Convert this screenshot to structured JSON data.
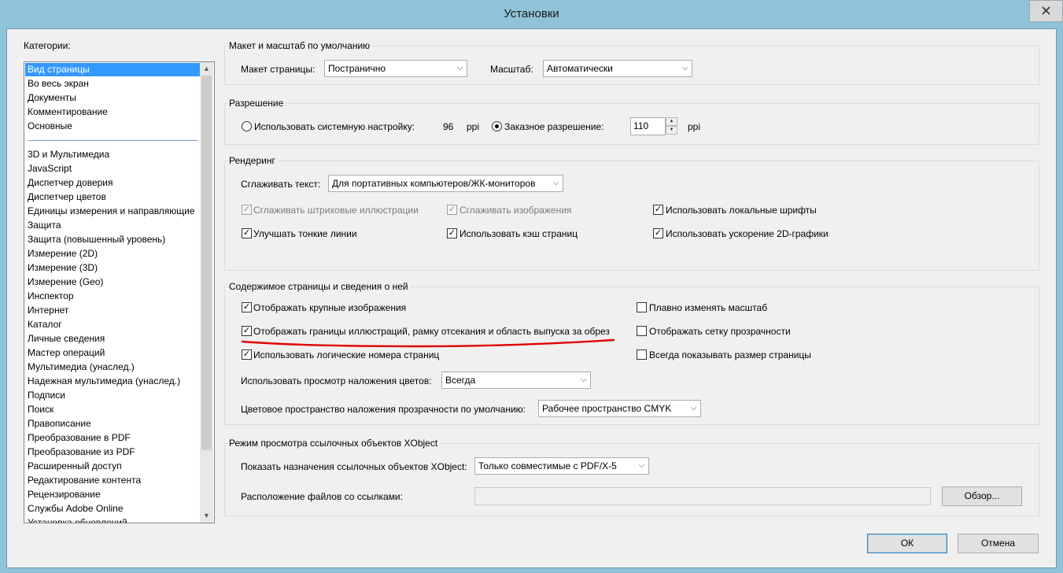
{
  "window": {
    "title": "Установки"
  },
  "categories": {
    "label": "Категории:",
    "group1": [
      "Вид страницы",
      "Во весь экран",
      "Документы",
      "Комментирование",
      "Основные"
    ],
    "group2": [
      "3D и Мультимедиа",
      "JavaScript",
      "Диспетчер доверия",
      "Диспетчер цветов",
      "Единицы измерения и направляющие",
      "Защита",
      "Защита (повышенный уровень)",
      "Измерение (2D)",
      "Измерение (3D)",
      "Измерение (Geo)",
      "Инспектор",
      "Интернет",
      "Каталог",
      "Личные сведения",
      "Мастер операций",
      "Мультимедиа (унаслед.)",
      "Надежная мультимедиа (унаслед.)",
      "Подписи",
      "Поиск",
      "Правописание",
      "Преобразование в PDF",
      "Преобразование из PDF",
      "Расширенный доступ",
      "Редактирование контента",
      "Рецензирование",
      "Службы Adobe Online",
      "Установка обновлений"
    ],
    "selected": "Вид страницы"
  },
  "layout_group": {
    "title": "Макет и масштаб по умолчанию",
    "page_layout_label": "Макет страницы:",
    "page_layout_value": "Постранично",
    "zoom_label": "Масштаб:",
    "zoom_value": "Автоматически"
  },
  "resolution_group": {
    "title": "Разрешение",
    "system_label": "Использовать системную настройку:",
    "system_value": "96",
    "unit": "ppi",
    "custom_label": "Заказное разрешение:",
    "custom_value": "110",
    "custom_unit": "ppi"
  },
  "rendering_group": {
    "title": "Рендеринг",
    "smooth_text_label": "Сглаживать текст:",
    "smooth_text_value": "Для портативных компьютеров/ЖК-мониторов",
    "cb_line_art": "Сглаживать штриховые иллюстрации",
    "cb_images": "Сглаживать изображения",
    "cb_local_fonts": "Использовать локальные шрифты",
    "cb_thin_lines": "Улучшать тонкие линии",
    "cb_page_cache": "Использовать кэш страниц",
    "cb_2d_accel": "Использовать ускорение 2D-графики"
  },
  "content_group": {
    "title": "Содержимое страницы и сведения о ней",
    "cb_large_images": "Отображать крупные изображения",
    "cb_smooth_zoom": "Плавно изменять масштаб",
    "cb_art_bleed": "Отображать границы иллюстраций, рамку отсекания и область выпуска за обрез",
    "cb_transparency_grid": "Отображать сетку прозрачности",
    "cb_logical_pages": "Использовать логические номера страниц",
    "cb_page_size": "Всегда показывать размер страницы",
    "overprint_label": "Использовать просмотр наложения цветов:",
    "overprint_value": "Всегда",
    "blend_label": "Цветовое пространство наложения прозрачности по умолчанию:",
    "blend_value": "Рабочее пространство CMYK"
  },
  "xobject_group": {
    "title": "Режим просмотра ссылочных объектов XObject",
    "show_label": "Показать назначения ссылочных объектов XObject:",
    "show_value": "Только совместимые с PDF/X-5",
    "location_label": "Расположение файлов со ссылками:",
    "location_value": "",
    "browse_label": "Обзор..."
  },
  "footer": {
    "ok_label": "ОК",
    "cancel_label": "Отмена"
  },
  "annotation": {
    "color": "#e00000"
  }
}
